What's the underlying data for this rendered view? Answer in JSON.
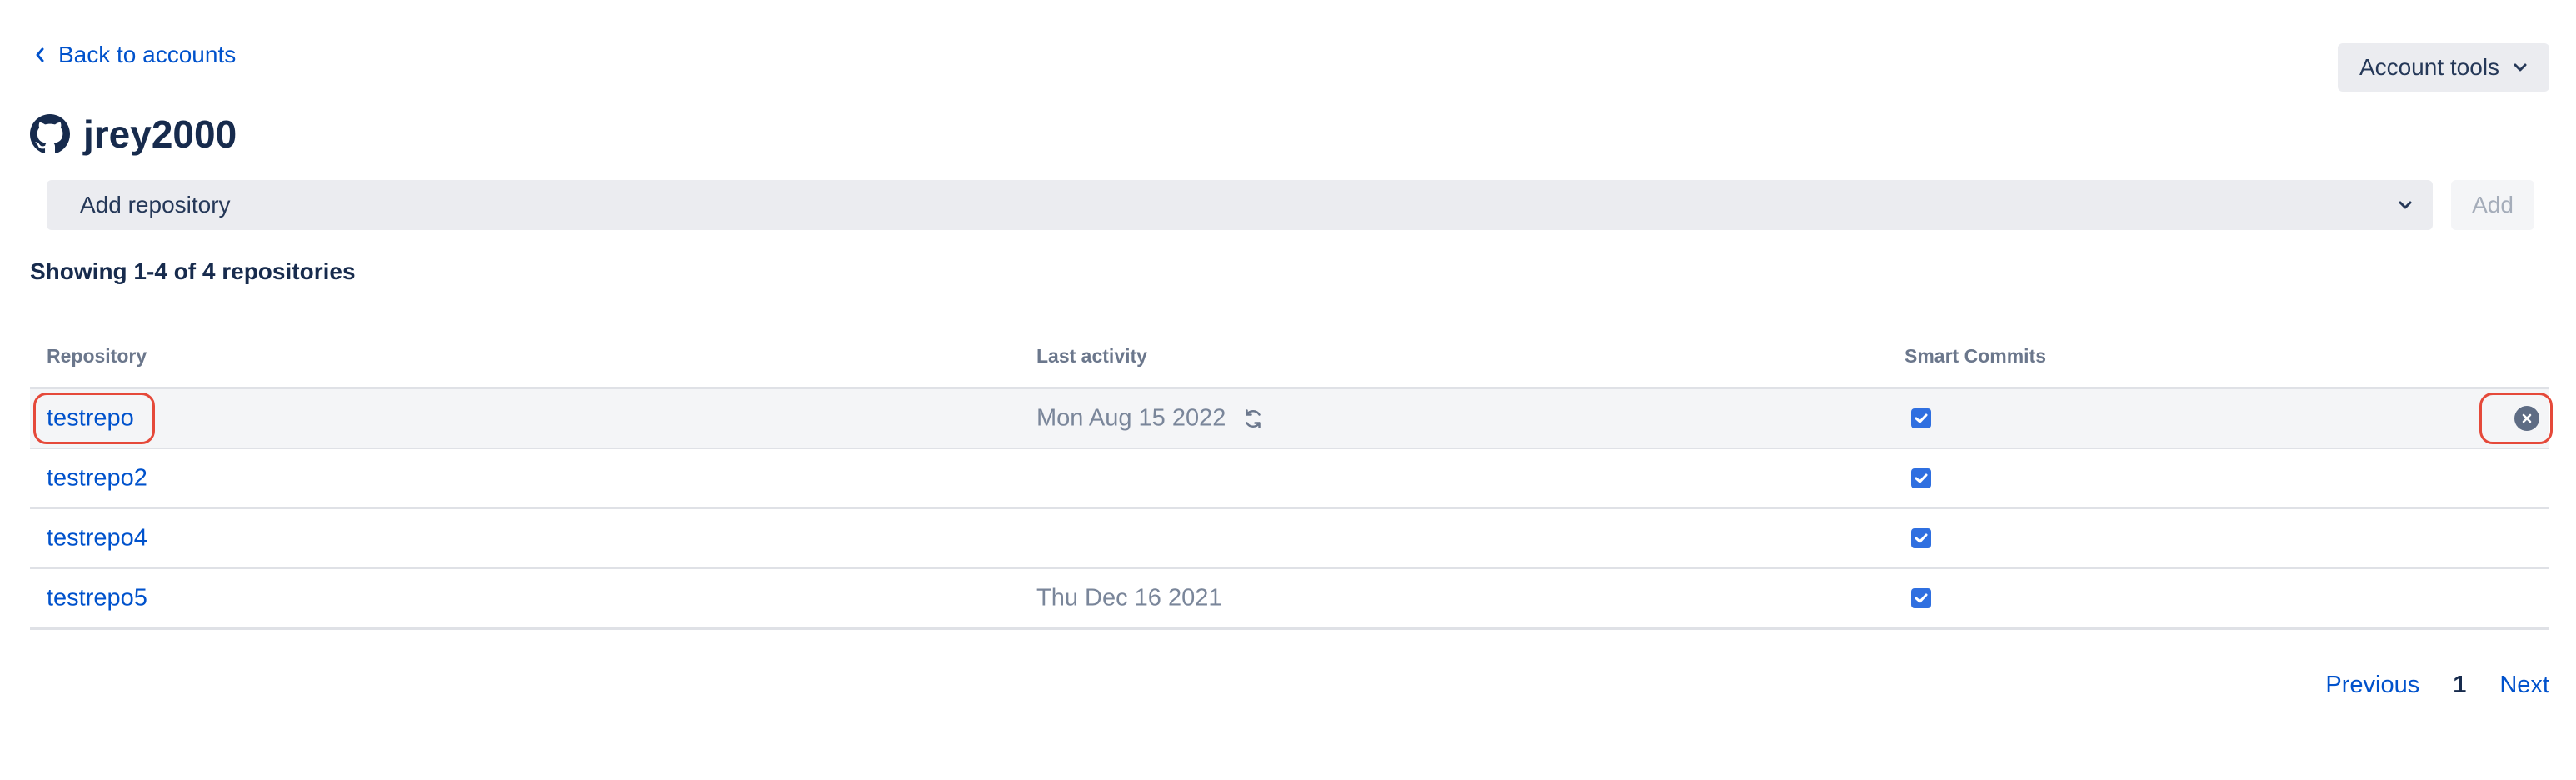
{
  "nav": {
    "back_label": "Back to accounts"
  },
  "header": {
    "title": "jrey2000",
    "account_tools_label": "Account tools"
  },
  "add_repository": {
    "placeholder": "Add repository",
    "add_button_label": "Add"
  },
  "summary": {
    "showing_text": "Showing 1-4 of 4 repositories"
  },
  "table": {
    "columns": [
      "Repository",
      "Last activity",
      "Smart Commits"
    ],
    "rows": [
      {
        "repository": "testrepo",
        "last_activity": "Mon Aug 15 2022",
        "smart_commits": true
      },
      {
        "repository": "testrepo2",
        "last_activity": "",
        "smart_commits": true
      },
      {
        "repository": "testrepo4",
        "last_activity": "",
        "smart_commits": true
      },
      {
        "repository": "testrepo5",
        "last_activity": "Thu Dec 16 2021",
        "smart_commits": true
      }
    ]
  },
  "pagination": {
    "previous_label": "Previous",
    "current_page": "1",
    "next_label": "Next"
  },
  "icons": {
    "back": "chevron-left-icon",
    "account_tools": "chevron-down-icon",
    "account": "github-icon",
    "select": "chevron-down-icon",
    "sync": "refresh-icon",
    "remove": "close-circle-icon",
    "checkbox": "checkmark-icon"
  },
  "colors": {
    "link": "#0052cc",
    "highlight": "#e5493a",
    "checkbox": "#2f6fe0"
  }
}
